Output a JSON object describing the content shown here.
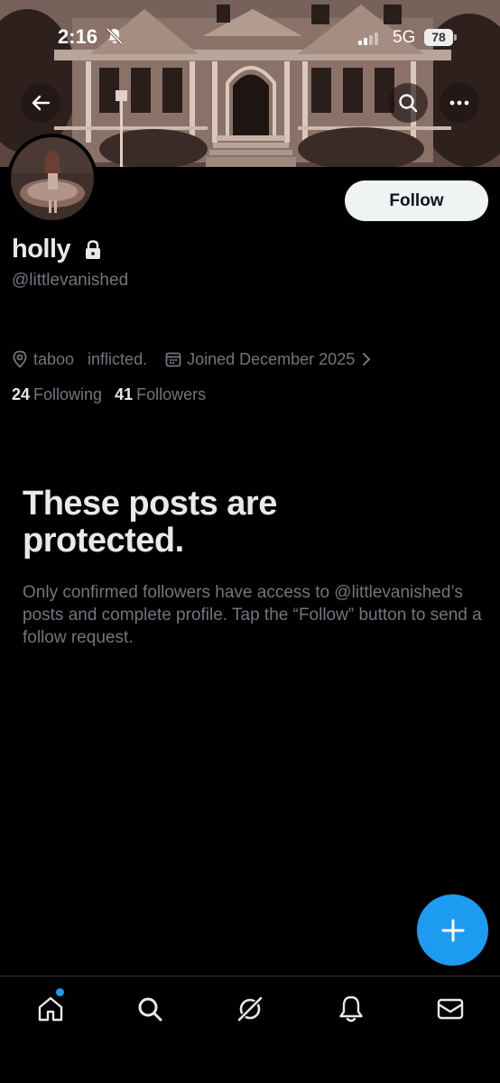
{
  "status_bar": {
    "time": "2:16",
    "network": "5G",
    "battery": "78"
  },
  "profile": {
    "display_name": "holly",
    "handle": "@littlevanished",
    "location": "taboo   inflicted.",
    "joined": "Joined December 2025",
    "following_count": "24",
    "following_label": "Following",
    "followers_count": "41",
    "followers_label": "Followers",
    "follow_button": "Follow"
  },
  "protected": {
    "title": "These posts are protected.",
    "body": "Only confirmed followers have access to @littlevanished’s posts and complete profile. Tap the “Follow” button to send a follow request."
  },
  "icons": {
    "back": "arrow-left-icon",
    "search": "search-icon",
    "more": "more-icon",
    "lock": "lock-icon",
    "location": "location-pin-icon",
    "calendar": "calendar-icon",
    "fab": "plus-icon",
    "nav": [
      "home-icon",
      "search-icon",
      "grok-icon",
      "bell-icon",
      "mail-icon"
    ]
  },
  "colors": {
    "accent": "#1d9bf0",
    "background": "#000000",
    "text_primary": "#e7e9ea",
    "text_secondary": "#71767b"
  }
}
